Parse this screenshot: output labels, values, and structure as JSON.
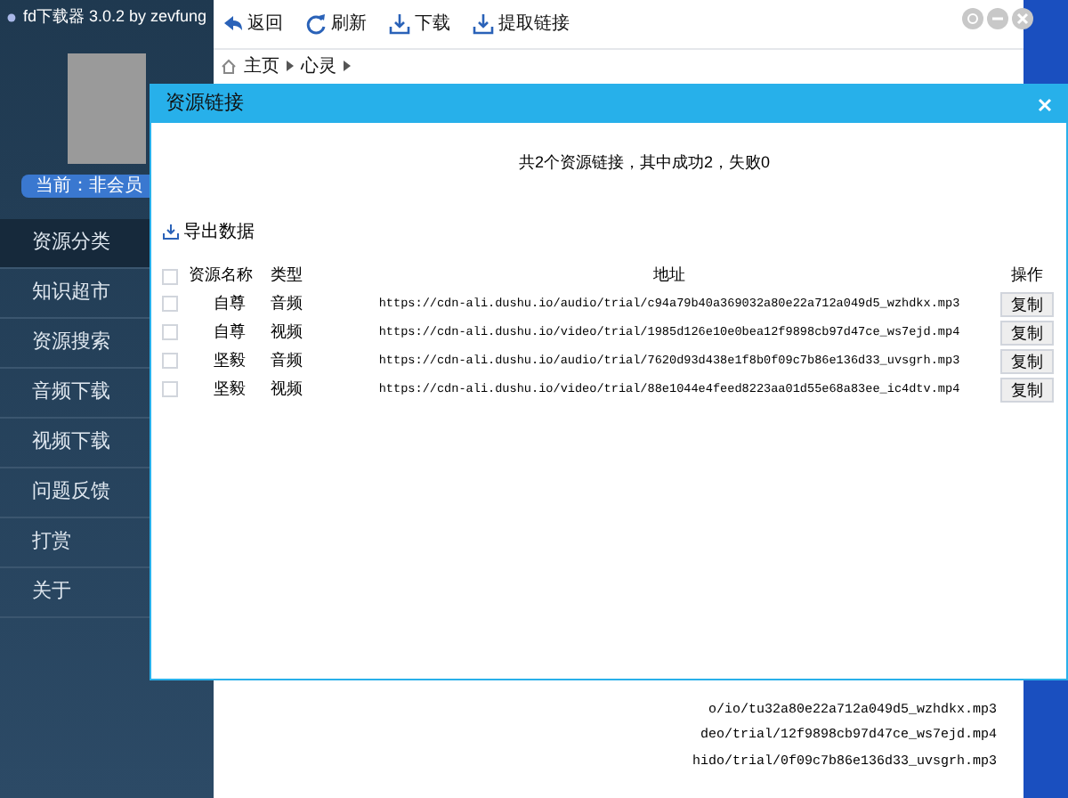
{
  "window": {
    "title": "fd下载器 3.0.2 by zevfung"
  },
  "user": {
    "status": "当前：非会员"
  },
  "sidebar": {
    "items": [
      {
        "label": "资源分类",
        "selected": true
      },
      {
        "label": "知识超市",
        "selected": false
      },
      {
        "label": "资源搜索",
        "selected": false
      },
      {
        "label": "音频下载",
        "selected": false
      },
      {
        "label": "视频下载",
        "selected": false
      },
      {
        "label": "问题反馈",
        "selected": false
      },
      {
        "label": "打赏",
        "selected": false
      },
      {
        "label": "关于",
        "selected": false
      }
    ]
  },
  "toolbar": [
    {
      "kind": "back",
      "label": "返回"
    },
    {
      "kind": "refresh",
      "label": "刷新"
    },
    {
      "kind": "download",
      "label": "下载"
    },
    {
      "kind": "download",
      "label": "提取链接"
    }
  ],
  "breadcrumb": [
    "主页",
    "心灵"
  ],
  "dialog": {
    "title": "资源链接",
    "summary": "共2个资源链接，其中成功2，失败0",
    "export_label": "导出数据",
    "table": {
      "select_all_checked": false,
      "columns": [
        "资源名称",
        "类型",
        "地址",
        "操作"
      ],
      "rows": [
        {
          "checked": false,
          "name": "自尊",
          "type": "音频",
          "url": "https://cdn-ali.dushu.io/audio/trial/c94a79b40a369032a80e22a712a049d5_wzhdkx.mp3",
          "action": "复制"
        },
        {
          "checked": false,
          "name": "自尊",
          "type": "视频",
          "url": "https://cdn-ali.dushu.io/video/trial/1985d126e10e0bea12f9898cb97d47ce_ws7ejd.mp4",
          "action": "复制"
        },
        {
          "checked": false,
          "name": "坚毅",
          "type": "音频",
          "url": "https://cdn-ali.dushu.io/audio/trial/7620d93d438e1f8b0f09c7b86e136d33_uvsgrh.mp3",
          "action": "复制"
        },
        {
          "checked": false,
          "name": "坚毅",
          "type": "视频",
          "url": "https://cdn-ali.dushu.io/video/trial/88e1044e4feed8223aa01d55e68a83ee_ic4dtv.mp4",
          "action": "复制"
        }
      ]
    }
  },
  "popup_lines": [
    "o/io/tu32a80e22a712a049d5_wzhdkx.mp3",
    "deo/trial/12f9898cb97d47ce_ws7ejd.mp4",
    "hido/trial/0f09c7b86e136d33_uvsgrh.mp3"
  ]
}
